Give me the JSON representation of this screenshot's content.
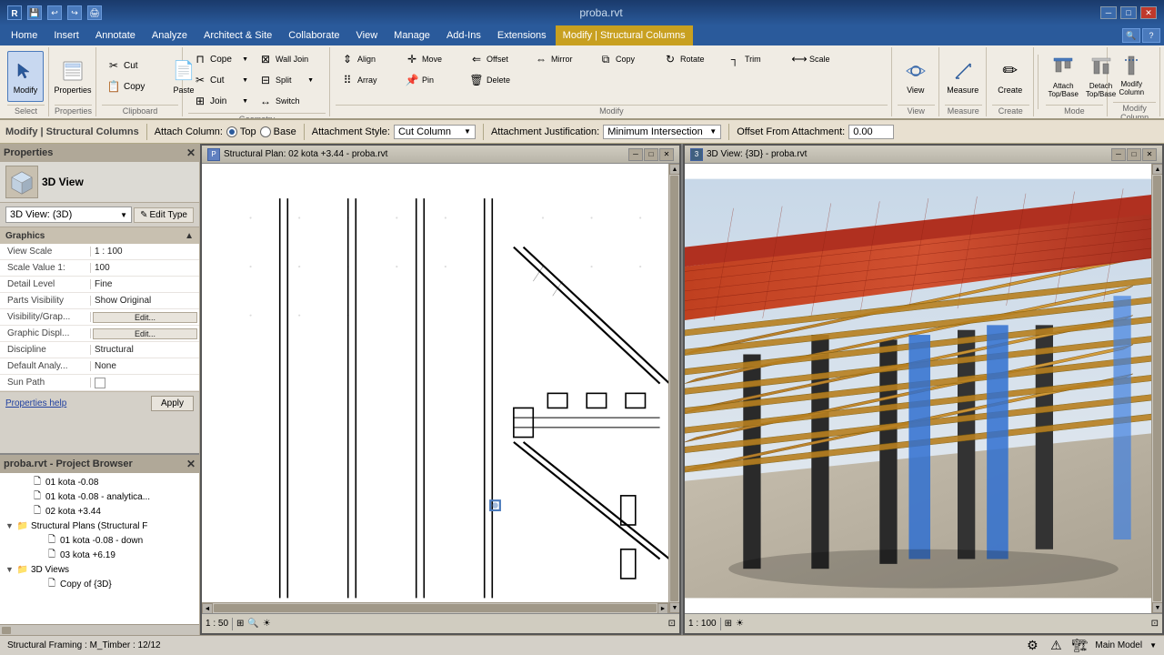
{
  "titleBar": {
    "title": "proba.rvt",
    "appName": "Autodesk Revit"
  },
  "menuBar": {
    "items": [
      "Home",
      "Insert",
      "Annotate",
      "Analyze",
      "Architect & Site",
      "Collaborate",
      "View",
      "Manage",
      "Add-Ins",
      "Extensions",
      "Modify | Structural Columns"
    ]
  },
  "ribbon": {
    "activeTab": "Modify | Structural Columns",
    "groups": {
      "select": {
        "label": "Select"
      },
      "properties": {
        "label": "Properties"
      },
      "clipboard": {
        "label": "Clipboard"
      },
      "geometry": {
        "label": "Geometry"
      },
      "modify": {
        "label": "Modify"
      },
      "view": {
        "label": "View"
      },
      "measure": {
        "label": "Measure"
      },
      "create": {
        "label": "Create"
      },
      "mode": {
        "label": "Mode"
      },
      "modifyColumn": {
        "label": "Modify Column"
      }
    },
    "buttons": {
      "cope": "Cope",
      "cut": "Cut",
      "join": "Join"
    }
  },
  "modeBar": {
    "label": "Modify | Structural Columns",
    "attachLabel": "Attach Column:",
    "topLabel": "Top",
    "baseLabel": "Base",
    "styleLabel": "Attachment Style:",
    "styleValue": "Cut Column",
    "justLabel": "Attachment Justification:",
    "justValue": "Minimum Intersection",
    "offsetLabel": "Offset From Attachment:",
    "offsetValue": "0.00"
  },
  "properties": {
    "title": "Properties",
    "typeName": "3D View",
    "typeDropdown": "3D View: (3D)",
    "editTypeLabel": "Edit Type",
    "graphics": {
      "sectionTitle": "Graphics",
      "rows": [
        {
          "label": "View Scale",
          "value": "1 : 100"
        },
        {
          "label": "Scale Value 1:",
          "value": "100"
        },
        {
          "label": "Detail Level",
          "value": "Fine"
        },
        {
          "label": "Parts Visibility",
          "value": "Show Original"
        },
        {
          "label": "Visibility/Grap...",
          "value": "Edit..."
        },
        {
          "label": "Graphic Displ...",
          "value": "Edit..."
        },
        {
          "label": "Discipline",
          "value": "Structural"
        },
        {
          "label": "Default Analy...",
          "value": "None"
        },
        {
          "label": "Sun Path",
          "value": ""
        }
      ]
    },
    "helpLink": "Properties help",
    "applyBtn": "Apply"
  },
  "projectBrowser": {
    "title": "proba.rvt - Project Browser",
    "items": [
      {
        "label": "01 kota -0.08",
        "indent": 1,
        "expanded": false
      },
      {
        "label": "01 kota -0.08 - analytica...",
        "indent": 1,
        "expanded": false
      },
      {
        "label": "02 kota +3.44",
        "indent": 1,
        "expanded": false
      },
      {
        "label": "Structural Plans (Structural F",
        "indent": 0,
        "expanded": true
      },
      {
        "label": "01 kota -0.08 - down",
        "indent": 2,
        "expanded": false
      },
      {
        "label": "03 kota +6.19",
        "indent": 2,
        "expanded": false
      },
      {
        "label": "3D Views",
        "indent": 0,
        "expanded": true
      },
      {
        "label": "Copy of {3D}",
        "indent": 2,
        "expanded": false
      }
    ]
  },
  "viewport1": {
    "title": "Structural Plan: 02 kota +3.44 - proba.rvt",
    "scale": "1 : 50"
  },
  "viewport2": {
    "title": "3D View: {3D} - proba.rvt",
    "scale": "1 : 100"
  },
  "statusBar": {
    "text": "Structural Framing : M_Timber : 12/12"
  }
}
